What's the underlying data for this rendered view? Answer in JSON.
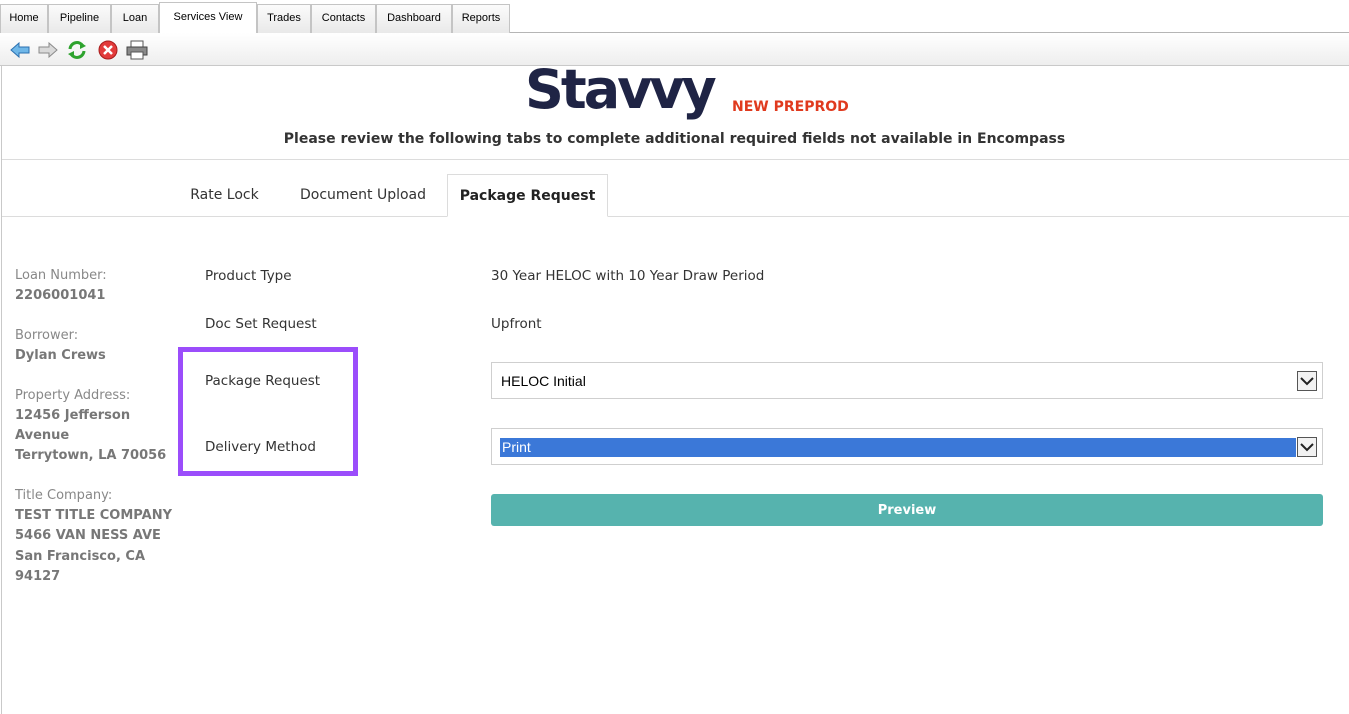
{
  "app_tabs": [
    {
      "label": "Home"
    },
    {
      "label": "Pipeline"
    },
    {
      "label": "Loan"
    },
    {
      "label": "Services View"
    },
    {
      "label": "Trades"
    },
    {
      "label": "Contacts"
    },
    {
      "label": "Dashboard"
    },
    {
      "label": "Reports"
    }
  ],
  "active_app_tab": "Services View",
  "toolbar_icons": [
    "back-arrow-icon",
    "forward-arrow-icon",
    "refresh-icon",
    "stop-icon",
    "print-icon"
  ],
  "header": {
    "logo": "Stavvy",
    "environment": "NEW PREPROD",
    "subtitle": "Please review the following tabs to complete additional required fields not available in Encompass"
  },
  "page_tabs": [
    {
      "label": "Rate Lock"
    },
    {
      "label": "Document Upload"
    },
    {
      "label": "Package Request"
    }
  ],
  "active_page_tab": "Package Request",
  "sidebar": {
    "loan_number_label": "Loan Number:",
    "loan_number": "2206001041",
    "borrower_label": "Borrower:",
    "borrower": "Dylan Crews",
    "property_label": "Property Address:",
    "property_line1": "12456 Jefferson",
    "property_line2": "Avenue",
    "property_line3": "Terrytown, LA 70056",
    "title_label": "Title Company:",
    "title_line1": "TEST TITLE COMPANY",
    "title_line2": "5466 VAN NESS AVE",
    "title_line3": "San Francisco, CA",
    "title_line4": "94127"
  },
  "form": {
    "product_type_label": "Product Type",
    "product_type_value": "30 Year HELOC with 10 Year Draw Period",
    "doc_set_label": "Doc Set Request",
    "doc_set_value": "Upfront",
    "package_request_label": "Package Request",
    "package_request_value": "HELOC Initial",
    "delivery_method_label": "Delivery Method",
    "delivery_method_value": "Print",
    "preview_label": "Preview"
  },
  "colors": {
    "logo": "#1f2445",
    "environment": "#e03a1e",
    "highlight_border": "#9b4dfb",
    "preview_button": "#56b3ae",
    "selected_option": "#3b78d8"
  }
}
